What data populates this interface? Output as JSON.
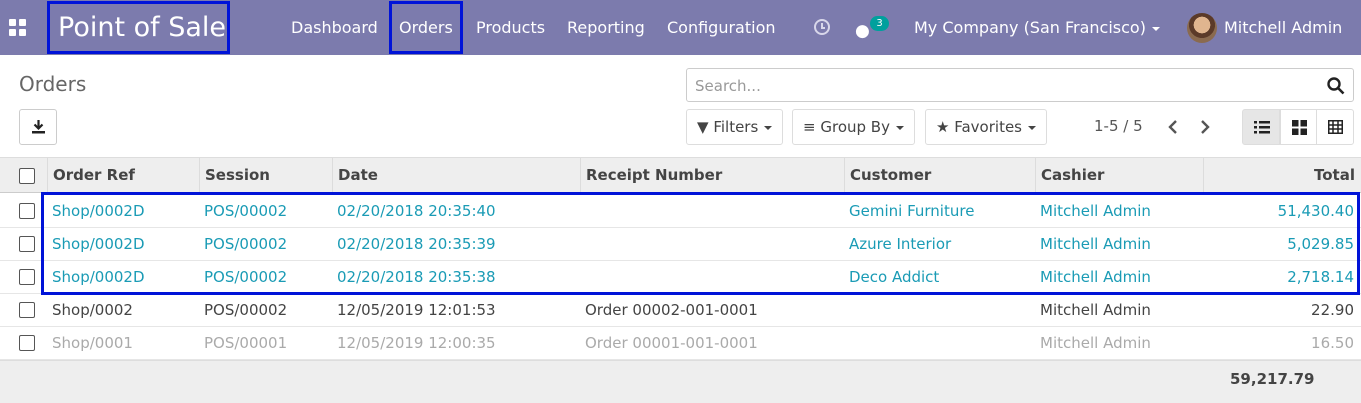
{
  "navbar": {
    "app_title": "Point of Sale",
    "menu": [
      "Dashboard",
      "Orders",
      "Products",
      "Reporting",
      "Configuration"
    ],
    "chat_count": "3",
    "company": "My Company (San Francisco)",
    "user": "Mitchell Admin",
    "background": "#7c7bad",
    "highlight_color": "#0013d8"
  },
  "control_panel": {
    "title": "Orders",
    "search_placeholder": "Search...",
    "filters_label": "Filters",
    "group_by_label": "Group By",
    "favorites_label": "Favorites",
    "pager": "1-5 / 5"
  },
  "table": {
    "columns": [
      "Order Ref",
      "Session",
      "Date",
      "Receipt Number",
      "Customer",
      "Cashier",
      "Total"
    ],
    "rows": [
      {
        "ref": "Shop/0002D",
        "session": "POS/00002",
        "date": "02/20/2018 20:35:40",
        "receipt": "",
        "customer": "Gemini Furniture",
        "cashier": "Mitchell Admin",
        "total": "51,430.40"
      },
      {
        "ref": "Shop/0002D",
        "session": "POS/00002",
        "date": "02/20/2018 20:35:39",
        "receipt": "",
        "customer": "Azure Interior",
        "cashier": "Mitchell Admin",
        "total": "5,029.85"
      },
      {
        "ref": "Shop/0002D",
        "session": "POS/00002",
        "date": "02/20/2018 20:35:38",
        "receipt": "",
        "customer": "Deco Addict",
        "cashier": "Mitchell Admin",
        "total": "2,718.14"
      },
      {
        "ref": "Shop/0002",
        "session": "POS/00002",
        "date": "12/05/2019 12:01:53",
        "receipt": "Order 00002-001-0001",
        "customer": "",
        "cashier": "Mitchell Admin",
        "total": "22.90"
      },
      {
        "ref": "Shop/0001",
        "session": "POS/00001",
        "date": "12/05/2019 12:00:35",
        "receipt": "Order 00001-001-0001",
        "customer": "",
        "cashier": "Mitchell Admin",
        "total": "16.50"
      }
    ],
    "grand_total": "59,217.79",
    "link_color": "#1a9bb5"
  }
}
